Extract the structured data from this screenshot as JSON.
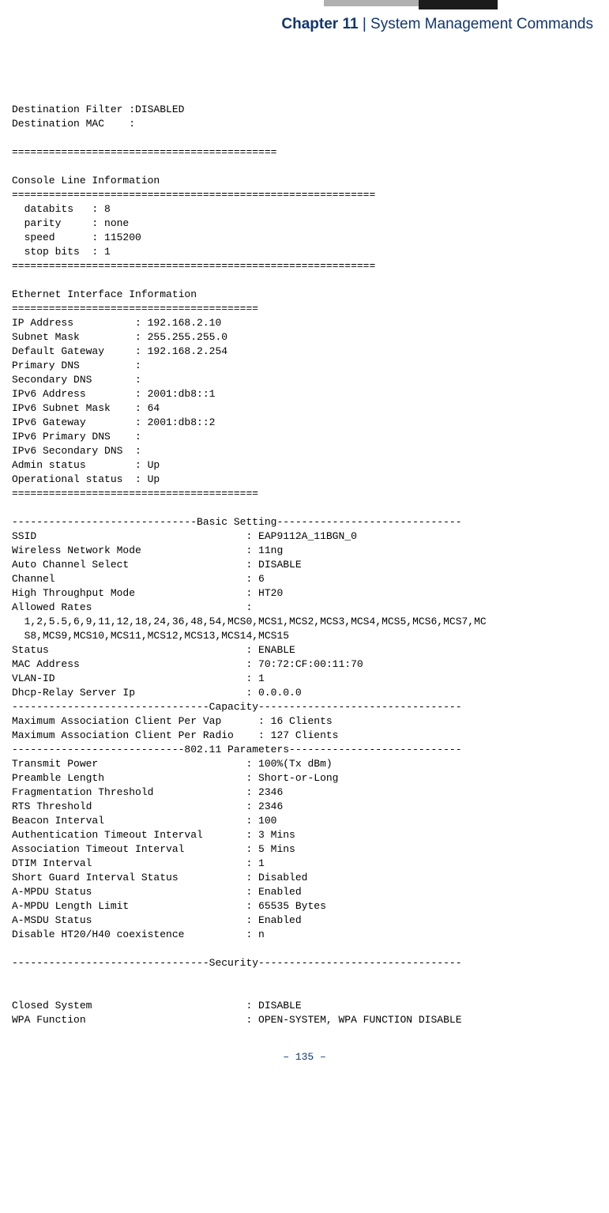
{
  "header": {
    "chapter": "Chapter 11",
    "divider": "  |  ",
    "title": "System Management Commands"
  },
  "console": {
    "l1": "Destination Filter :DISABLED",
    "l2": "Destination MAC    :",
    "l3": "",
    "l4": "===========================================",
    "l5": "",
    "l6": "Console Line Information",
    "l7": "===========================================================",
    "l8": "  databits   : 8",
    "l9": "  parity     : none",
    "l10": "  speed      : 115200",
    "l11": "  stop bits  : 1",
    "l12": "===========================================================",
    "l13": "",
    "l14": "Ethernet Interface Information",
    "l15": "========================================",
    "l16": "IP Address          : 192.168.2.10",
    "l17": "Subnet Mask         : 255.255.255.0",
    "l18": "Default Gateway     : 192.168.2.254",
    "l19": "Primary DNS         :",
    "l20": "Secondary DNS       :",
    "l21": "IPv6 Address        : 2001:db8::1",
    "l22": "IPv6 Subnet Mask    : 64",
    "l23": "IPv6 Gateway        : 2001:db8::2",
    "l24": "IPv6 Primary DNS    :",
    "l25": "IPv6 Secondary DNS  :",
    "l26": "Admin status        : Up",
    "l27": "Operational status  : Up",
    "l28": "========================================",
    "l29": "",
    "l30": "------------------------------Basic Setting------------------------------",
    "l31": "SSID                                  : EAP9112A_11BGN_0",
    "l32": "Wireless Network Mode                 : 11ng",
    "l33": "Auto Channel Select                   : DISABLE",
    "l34": "Channel                               : 6",
    "l35": "High Throughput Mode                  : HT20",
    "l36": "Allowed Rates                         : ",
    "l37": "  1,2,5.5,6,9,11,12,18,24,36,48,54,MCS0,MCS1,MCS2,MCS3,MCS4,MCS5,MCS6,MCS7,MC",
    "l38": "  S8,MCS9,MCS10,MCS11,MCS12,MCS13,MCS14,MCS15",
    "l39": "Status                                : ENABLE",
    "l40": "MAC Address                           : 70:72:CF:00:11:70",
    "l41": "VLAN-ID                               : 1",
    "l42": "Dhcp-Relay Server Ip                  : 0.0.0.0",
    "l43": "--------------------------------Capacity---------------------------------",
    "l44": "Maximum Association Client Per Vap      : 16 Clients",
    "l45": "Maximum Association Client Per Radio    : 127 Clients",
    "l46": "----------------------------802.11 Parameters----------------------------",
    "l47": "Transmit Power                        : 100%(Tx dBm)",
    "l48": "Preamble Length                       : Short-or-Long",
    "l49": "Fragmentation Threshold               : 2346",
    "l50": "RTS Threshold                         : 2346",
    "l51": "Beacon Interval                       : 100",
    "l52": "Authentication Timeout Interval       : 3 Mins",
    "l53": "Association Timeout Interval          : 5 Mins",
    "l54": "DTIM Interval                         : 1",
    "l55": "Short Guard Interval Status           : Disabled",
    "l56": "A-MPDU Status                         : Enabled",
    "l57": "A-MPDU Length Limit                   : 65535 Bytes",
    "l58": "A-MSDU Status                         : Enabled",
    "l59": "Disable HT20/H40 coexistence          : n",
    "l60": "",
    "l61": "--------------------------------Security---------------------------------",
    "l62": "",
    "l63": "",
    "l64": "Closed System                         : DISABLE",
    "l65": "WPA Function                          : OPEN-SYSTEM, WPA FUNCTION DISABLE"
  },
  "pagenum": "– 135 –"
}
